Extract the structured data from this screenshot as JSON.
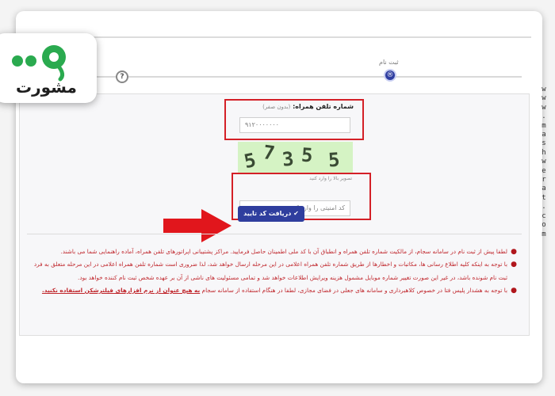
{
  "brand": {
    "name": "مشورت",
    "side_url": "www.mashwerat.com",
    "colors": {
      "green": "#2aaa4f",
      "dark": "#1e1e1e"
    }
  },
  "steps": {
    "current_label": "ثبت نام",
    "done_icon": "check-circle-icon",
    "done_glyph": "®",
    "next_glyph": "?"
  },
  "form": {
    "phone_label": "شماره تلفن همراه:",
    "phone_hint": "(بدون صفر)",
    "phone_value": "۹۱۲۰۰۰۰۰۰۰",
    "captcha_chars": [
      "5",
      "7",
      "3",
      "5",
      "5"
    ],
    "code_hint": "تصویر بالا را وارد کنید",
    "code_placeholder": "کد امنیتی را وارد کنید",
    "submit_label": "دریافت کد تایید",
    "submit_icon": "check-icon"
  },
  "notes": [
    {
      "text": "لطفا پیش از ثبت نام در سامانه سجام، از مالکیت شماره تلفن همراه و انطباق آن با کد ملی اطمینان حاصل فرمایید. مراکز پشتیبانی اپراتورهای تلفن همراه، آماده راهنمایی شما می باشند."
    },
    {
      "text": "با توجه به اینکه کلیه اطلاع رسانی ها، مکاتبات و اخطارها از طریق شماره تلفن همراه اعلامی در این مرحله ارسال خواهد شد، لذا ضروری است شماره تلفن همراه اعلامی در این مرحله متعلق به فرد ثبت نام شونده باشد، در غیر این صورت تغییر شماره موبایل مشمول هزینه ویرایش اطلاعات خواهد شد و تمامی مسئولیت های ناشی از آن بر عهده شخص ثبت نام کننده خواهد بود."
    },
    {
      "text": "با توجه به هشدار پلیس فتا در خصوص کلاهبرداری و سامانه های جعلی در فضای مجازی، لطفا در هنگام استفاده از سامانه سجام",
      "strong": "به هیچ عنوان از نرم افزارهای فیلترشکن استفاده نکنید."
    }
  ],
  "accent": {
    "red": "#d42027",
    "blue": "#2f3e9e"
  }
}
